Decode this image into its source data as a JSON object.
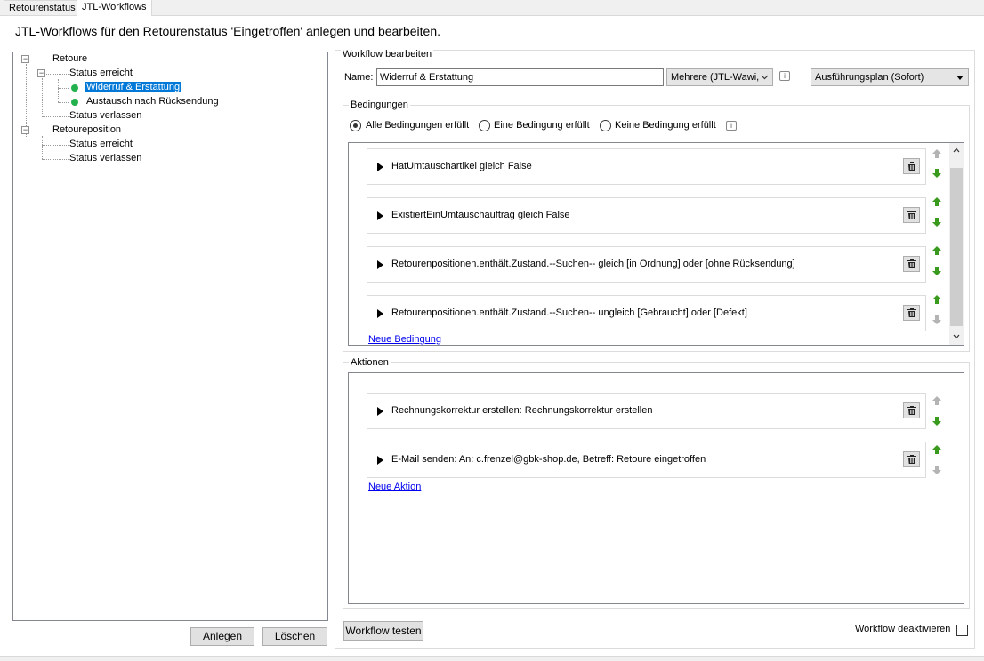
{
  "tabs": [
    {
      "label": "Retourenstatus"
    },
    {
      "label": "JTL-Workflows"
    }
  ],
  "page": {
    "title": "JTL-Workflows für den Retourenstatus 'Eingetroffen' anlegen und bearbeiten."
  },
  "tree": {
    "retoure": "Retoure",
    "status_erreicht": "Status erreicht",
    "widerruf": "Widerruf & Erstattung",
    "austausch": "Austausch nach Rücksendung",
    "status_verlassen": "Status verlassen",
    "retoureposition": "Retoureposition",
    "pos_status_erreicht": "Status erreicht",
    "pos_status_verlassen": "Status verlassen"
  },
  "buttons": {
    "anlegen": "Anlegen",
    "loeschen": "Löschen",
    "workflow_testen": "Workflow testen"
  },
  "workflow": {
    "group_title": "Workflow bearbeiten",
    "name_label": "Name:",
    "name_value": "Widerruf & Erstattung",
    "mehrere": "Mehrere (JTL-Wawi,",
    "ausfuehrungsplan": "Ausführungsplan (Sofort)",
    "deaktivieren_label": "Workflow deaktivieren"
  },
  "bedingungen": {
    "title": "Bedingungen",
    "radio_all": "Alle Bedingungen erfüllt",
    "radio_one": "Eine Bedingung erfüllt",
    "radio_none": "Keine Bedingung erfüllt",
    "items": [
      {
        "text": "HatUmtauschartikel gleich False"
      },
      {
        "text": "ExistiertEinUmtauschauftrag gleich False"
      },
      {
        "text": "Retourenpositionen.enthält.Zustand.--Suchen-- gleich [in Ordnung] oder [ohne Rücksendung]"
      },
      {
        "text": "Retourenpositionen.enthält.Zustand.--Suchen-- ungleich [Gebraucht] oder [Defekt]"
      }
    ],
    "new_link": "Neue Bedingung"
  },
  "aktionen": {
    "title": "Aktionen",
    "items": [
      {
        "text": "Rechnungskorrektur erstellen: Rechnungskorrektur erstellen"
      },
      {
        "text": "E-Mail senden: An: c.frenzel@gbk-shop.de, Betreff: Retoure eingetroffen"
      }
    ],
    "new_link": "Neue Aktion"
  },
  "colors": {
    "selection": "#0078d7",
    "status_dot": "#22b14c",
    "arrow_green": "#3a9a1e",
    "arrow_gray": "#b4b4b4",
    "link": "#0000ee"
  }
}
